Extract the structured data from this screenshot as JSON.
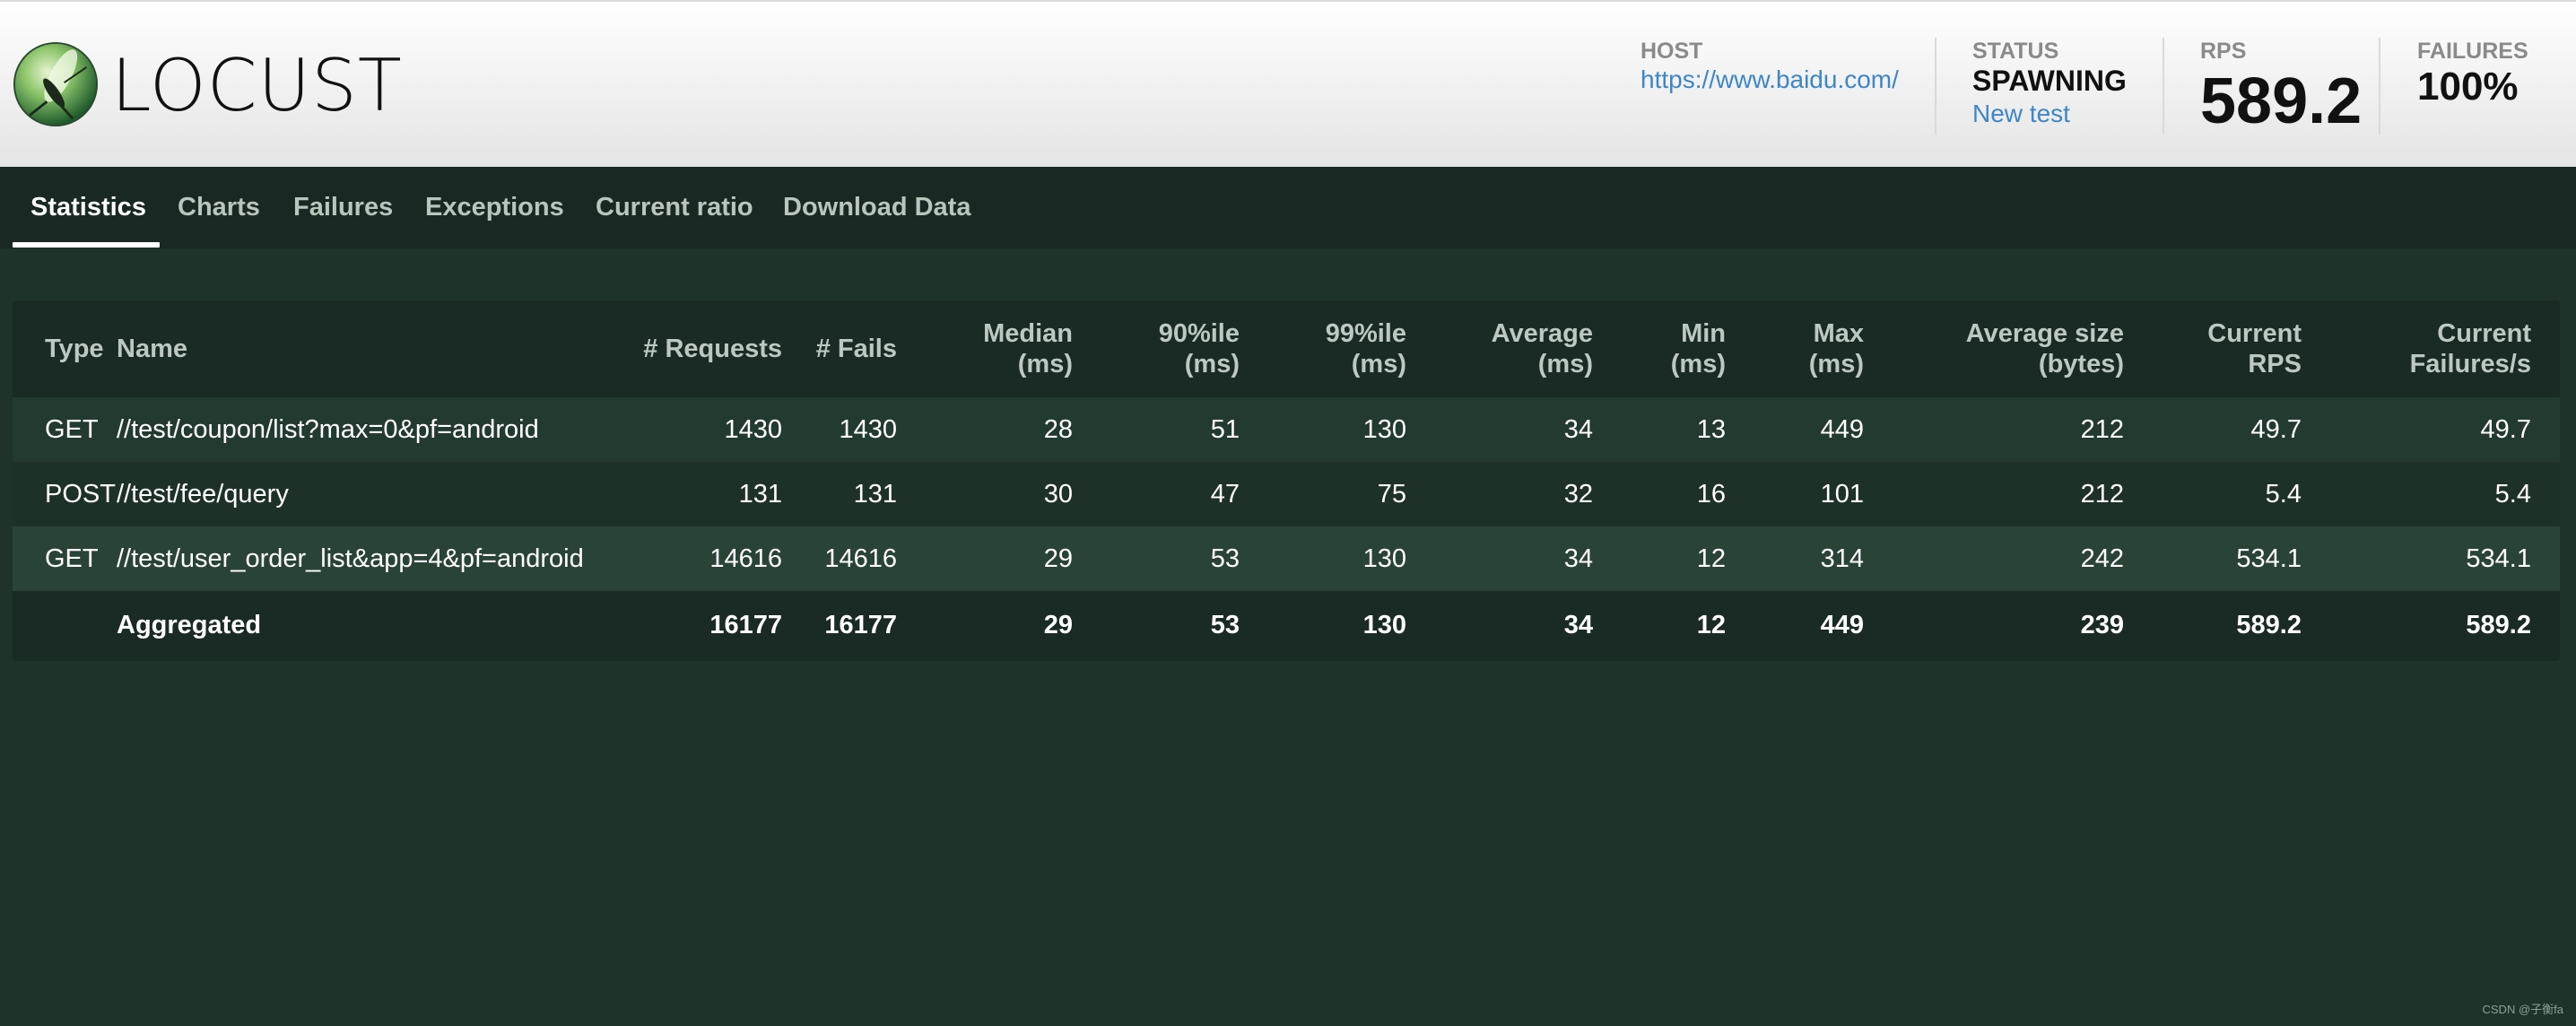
{
  "brand": {
    "name": "LOCUST",
    "logo_icon": "locust-insect-icon"
  },
  "header": {
    "host": {
      "label": "HOST",
      "value": "https://www.baidu.com/"
    },
    "status": {
      "label": "STATUS",
      "value": "SPAWNING",
      "action": "New test"
    },
    "rps": {
      "label": "RPS",
      "value": "589.2"
    },
    "failures": {
      "label": "FAILURES",
      "value": "100%"
    }
  },
  "tabs": [
    {
      "label": "Statistics",
      "active": true
    },
    {
      "label": "Charts"
    },
    {
      "label": "Failures"
    },
    {
      "label": "Exceptions"
    },
    {
      "label": "Current ratio"
    },
    {
      "label": "Download Data"
    }
  ],
  "table": {
    "columns": [
      {
        "line1": "",
        "line2": "Type"
      },
      {
        "line1": "",
        "line2": "Name"
      },
      {
        "line1": "",
        "line2": "# Requests"
      },
      {
        "line1": "",
        "line2": "# Fails"
      },
      {
        "line1": "Median",
        "line2": "(ms)"
      },
      {
        "line1": "90%ile",
        "line2": "(ms)"
      },
      {
        "line1": "99%ile",
        "line2": "(ms)"
      },
      {
        "line1": "Average",
        "line2": "(ms)"
      },
      {
        "line1": "Min",
        "line2": "(ms)"
      },
      {
        "line1": "Max",
        "line2": "(ms)"
      },
      {
        "line1": "Average size",
        "line2": "(bytes)"
      },
      {
        "line1": "Current",
        "line2": "RPS"
      },
      {
        "line1": "Current",
        "line2": "Failures/s"
      }
    ],
    "rows": [
      [
        "GET",
        "//test/coupon/list?max=0&pf=android",
        "1430",
        "1430",
        "28",
        "51",
        "130",
        "34",
        "13",
        "449",
        "212",
        "49.7",
        "49.7"
      ],
      [
        "POST",
        "//test/fee/query",
        "131",
        "131",
        "30",
        "47",
        "75",
        "32",
        "16",
        "101",
        "212",
        "5.4",
        "5.4"
      ],
      [
        "GET",
        "//test/user_order_list&app=4&pf=android",
        "14616",
        "14616",
        "29",
        "53",
        "130",
        "34",
        "12",
        "314",
        "242",
        "534.1",
        "534.1"
      ]
    ],
    "aggregated": [
      "",
      "Aggregated",
      "16177",
      "16177",
      "29",
      "53",
      "130",
      "34",
      "12",
      "449",
      "239",
      "589.2",
      "589.2"
    ]
  },
  "watermark": "CSDN @子衡fa",
  "colors": {
    "page_bg": "#1f332b",
    "tabs_bg": "#192822",
    "link": "#3d86c6",
    "row_highlight": "#2a4337"
  }
}
